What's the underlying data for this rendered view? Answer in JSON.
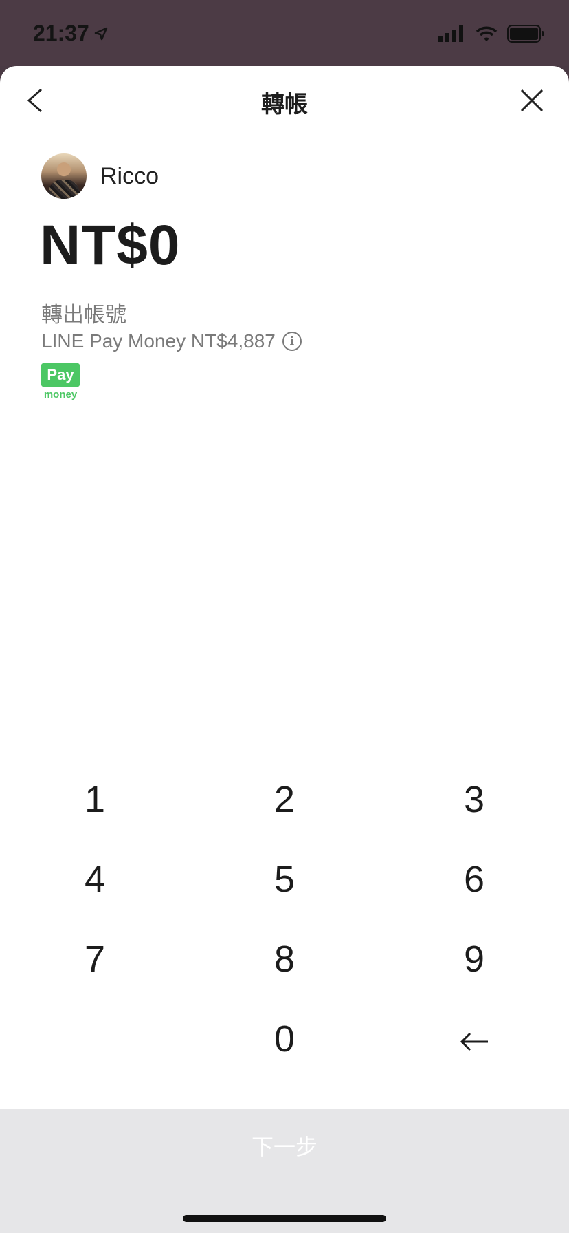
{
  "status": {
    "time": "21:37"
  },
  "nav": {
    "title": "轉帳"
  },
  "recipient": {
    "name": "Ricco"
  },
  "amount": "NT$0",
  "source": {
    "label": "轉出帳號",
    "balance": "LINE Pay Money NT$4,887",
    "logo_top": "Pay",
    "logo_bottom": "money"
  },
  "keypad": {
    "k1": "1",
    "k2": "2",
    "k3": "3",
    "k4": "4",
    "k5": "5",
    "k6": "6",
    "k7": "7",
    "k8": "8",
    "k9": "9",
    "k0": "0"
  },
  "footer": {
    "next_label": "下一步"
  },
  "colors": {
    "accent_green": "#4cc764",
    "footer_bg": "#e6e6e8"
  }
}
